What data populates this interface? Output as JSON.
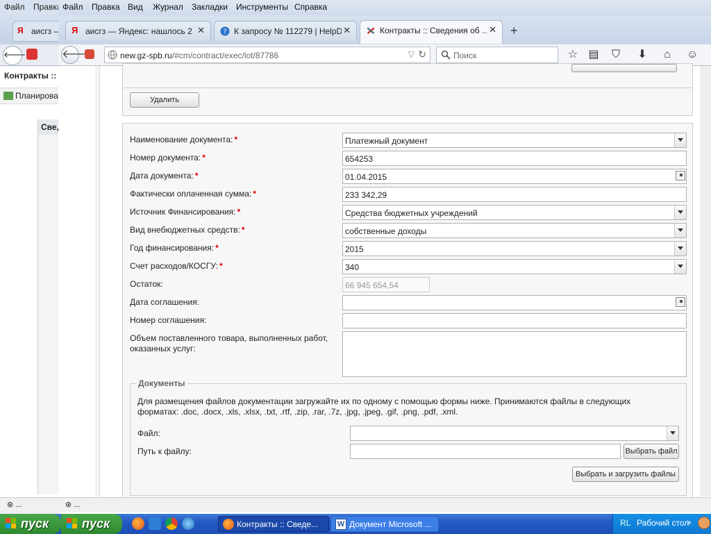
{
  "background_window": {
    "menu": [
      "Файл",
      "Правка"
    ],
    "tab_title": "аисгз —",
    "header_title": "Контракты ::",
    "sidebar_item": "Планирован",
    "tab_label": "Све,",
    "status_text": "⊛ ..."
  },
  "menubar": {
    "items": [
      "Файл",
      "Правка",
      "Вид",
      "Журнал",
      "Закладки",
      "Инструменты",
      "Справка"
    ]
  },
  "tabs": [
    {
      "title": "аисгз — Яндекс: нашлось 2...",
      "icon": "yandex-icon",
      "active": false
    },
    {
      "title": "К запросу № 112279 | HelpD...",
      "icon": "helpdesk-icon",
      "active": false
    },
    {
      "title": "Контракты :: Сведения об ...",
      "icon": "tools-icon",
      "active": true
    }
  ],
  "navbar": {
    "url_host": "new.gz-spb.ru",
    "url_path": "/#cm/contract/exec/lot/87786",
    "search_placeholder": "Поиск"
  },
  "page": {
    "delete_button": "Удалить",
    "form": {
      "doc_name_label": "Наименование документа:",
      "doc_name_value": "Платежный документ",
      "doc_number_label": "Номер документа:",
      "doc_number_value": "654253",
      "doc_date_label": "Дата документа:",
      "doc_date_value": "01.04.2015",
      "paid_label": "Фактически оплаченная сумма:",
      "paid_value": "233 342,29",
      "source_label": "Источник Финансирования:",
      "source_value": "Средства бюджетных учреждений",
      "offbudget_label": "Вид внебюджетных средств:",
      "offbudget_value": "собственные доходы",
      "year_label": "Год финансирования:",
      "year_value": "2015",
      "account_label": "Счет расходов/КОСГУ:",
      "account_value": "340",
      "remainder_label": "Остаток:",
      "remainder_value": "66 945 654,54",
      "agreement_date_label": "Дата соглашения:",
      "agreement_date_value": "",
      "agreement_number_label": "Номер соглашения:",
      "agreement_number_value": "",
      "volume_label_line1": "Объем поставленного товара, выполненных работ,",
      "volume_label_line2": "оказанных услуг:",
      "volume_value": ""
    },
    "documents": {
      "legend": "Документы",
      "info_line1": "Для размещения файлов документации загружайте их по одному с помощью формы ниже. Принимаются файлы в следующих",
      "info_line2": "форматах: .doc, .docx, .xls, .xlsx, .txt, .rtf, .zip, .rar, .7z, .jpg, .jpeg, .gif, .png, .pdf, .xml.",
      "file_label": "Файл:",
      "file_value": "",
      "path_label": "Путь к файлу:",
      "path_value": "",
      "choose_file_button": "Выбрать файл",
      "upload_button": "Выбрать и загрузить файлы"
    }
  },
  "statusbar": {
    "text": "⊛ ..."
  },
  "taskbar": {
    "start_label": "пуск",
    "tasks": [
      {
        "title": "Контракты :: Сведе...",
        "icon": "firefox-icon",
        "active": true
      },
      {
        "title": "Документ Microsoft ...",
        "icon": "word-icon",
        "active": false
      }
    ],
    "tray_lang": "RL",
    "tray_desktop": "Рабочий стол"
  },
  "colors": {
    "required_star": "#dd0000",
    "taskbar_blue": "#2459c4",
    "start_green": "#3a983a"
  }
}
